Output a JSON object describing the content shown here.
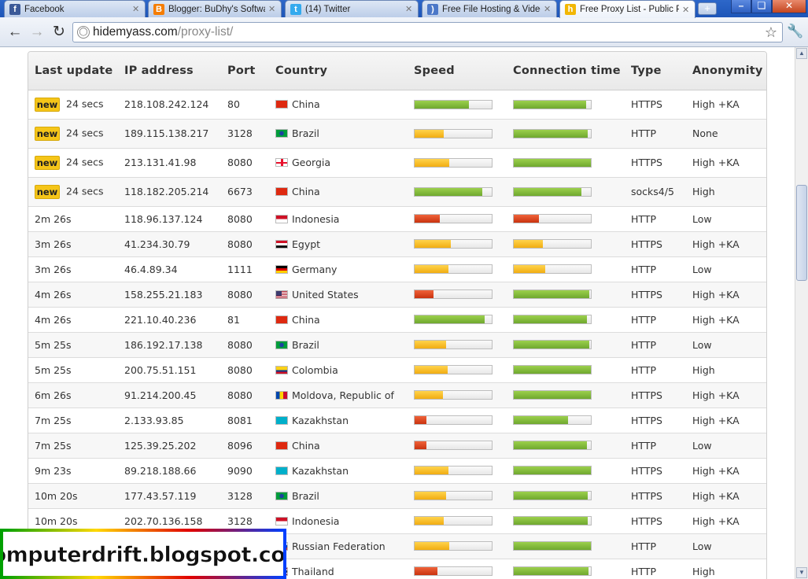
{
  "tabs": [
    {
      "label": "Facebook",
      "icon": "facebook-icon",
      "color": "#3b5998",
      "glyph": "f"
    },
    {
      "label": "Blogger: BuDhy's Software",
      "icon": "blogger-icon",
      "color": "#f57d00",
      "glyph": "B"
    },
    {
      "label": "(14) Twitter",
      "icon": "twitter-icon",
      "color": "#33aaee",
      "glyph": "t"
    },
    {
      "label": "Free File Hosting & Video D",
      "icon": "loading-icon",
      "color": "#4c78c8",
      "glyph": ")"
    },
    {
      "label": "Free Proxy List - Public Pro",
      "icon": "hidemyass-icon",
      "color": "#f2b705",
      "glyph": "h",
      "active": true
    }
  ],
  "address_bar": {
    "host": "hidemyass.com",
    "path": "/proxy-list/"
  },
  "table": {
    "headers": [
      "Last update",
      "IP address",
      "Port",
      "Country",
      "Speed",
      "Connection time",
      "Type",
      "Anonymity"
    ],
    "new_label": "new",
    "rows": [
      {
        "new": true,
        "update": "24 secs",
        "ip": "218.108.242.124",
        "port": "80",
        "country": "China",
        "flag": "cn",
        "speed": 0.7,
        "speed_level": "fast",
        "conn": 0.94,
        "conn_level": "fast",
        "type": "HTTPS",
        "anon": "High +KA"
      },
      {
        "new": true,
        "update": "24 secs",
        "ip": "189.115.138.217",
        "port": "3128",
        "country": "Brazil",
        "flag": "br",
        "speed": 0.38,
        "speed_level": "medium",
        "conn": 0.96,
        "conn_level": "fast",
        "type": "HTTP",
        "anon": "None"
      },
      {
        "new": true,
        "update": "24 secs",
        "ip": "213.131.41.98",
        "port": "8080",
        "country": "Georgia",
        "flag": "ge",
        "speed": 0.45,
        "speed_level": "medium",
        "conn": 1.0,
        "conn_level": "fast",
        "type": "HTTPS",
        "anon": "High +KA"
      },
      {
        "new": true,
        "update": "24 secs",
        "ip": "118.182.205.214",
        "port": "6673",
        "country": "China",
        "flag": "cn",
        "speed": 0.88,
        "speed_level": "fast",
        "conn": 0.88,
        "conn_level": "fast",
        "type": "socks4/5",
        "anon": "High"
      },
      {
        "new": false,
        "update": "2m 26s",
        "ip": "118.96.137.124",
        "port": "8080",
        "country": "Indonesia",
        "flag": "id",
        "speed": 0.33,
        "speed_level": "slow",
        "conn": 0.33,
        "conn_level": "slow",
        "type": "HTTP",
        "anon": "Low"
      },
      {
        "new": false,
        "update": "3m 26s",
        "ip": "41.234.30.79",
        "port": "8080",
        "country": "Egypt",
        "flag": "eg",
        "speed": 0.47,
        "speed_level": "medium",
        "conn": 0.38,
        "conn_level": "medium",
        "type": "HTTPS",
        "anon": "High +KA"
      },
      {
        "new": false,
        "update": "3m 26s",
        "ip": "46.4.89.34",
        "port": "1111",
        "country": "Germany",
        "flag": "de",
        "speed": 0.44,
        "speed_level": "medium",
        "conn": 0.41,
        "conn_level": "medium",
        "type": "HTTP",
        "anon": "Low"
      },
      {
        "new": false,
        "update": "4m 26s",
        "ip": "158.255.21.183",
        "port": "8080",
        "country": "United States",
        "flag": "us",
        "speed": 0.24,
        "speed_level": "slow",
        "conn": 0.98,
        "conn_level": "fast",
        "type": "HTTPS",
        "anon": "High +KA"
      },
      {
        "new": false,
        "update": "4m 26s",
        "ip": "221.10.40.236",
        "port": "81",
        "country": "China",
        "flag": "cn",
        "speed": 0.91,
        "speed_level": "fast",
        "conn": 0.95,
        "conn_level": "fast",
        "type": "HTTP",
        "anon": "High +KA"
      },
      {
        "new": false,
        "update": "5m 25s",
        "ip": "186.192.17.138",
        "port": "8080",
        "country": "Brazil",
        "flag": "br",
        "speed": 0.41,
        "speed_level": "medium",
        "conn": 0.98,
        "conn_level": "fast",
        "type": "HTTP",
        "anon": "Low"
      },
      {
        "new": false,
        "update": "5m 25s",
        "ip": "200.75.51.151",
        "port": "8080",
        "country": "Colombia",
        "flag": "co",
        "speed": 0.43,
        "speed_level": "medium",
        "conn": 1.0,
        "conn_level": "fast",
        "type": "HTTP",
        "anon": "High"
      },
      {
        "new": false,
        "update": "6m 26s",
        "ip": "91.214.200.45",
        "port": "8080",
        "country": "Moldova, Republic of",
        "flag": "md",
        "speed": 0.37,
        "speed_level": "medium",
        "conn": 1.0,
        "conn_level": "fast",
        "type": "HTTPS",
        "anon": "High +KA"
      },
      {
        "new": false,
        "update": "7m 25s",
        "ip": "2.133.93.85",
        "port": "8081",
        "country": "Kazakhstan",
        "flag": "kz",
        "speed": 0.15,
        "speed_level": "slow",
        "conn": 0.7,
        "conn_level": "fast",
        "type": "HTTPS",
        "anon": "High +KA"
      },
      {
        "new": false,
        "update": "7m 25s",
        "ip": "125.39.25.202",
        "port": "8096",
        "country": "China",
        "flag": "cn",
        "speed": 0.15,
        "speed_level": "slow",
        "conn": 0.95,
        "conn_level": "fast",
        "type": "HTTP",
        "anon": "Low"
      },
      {
        "new": false,
        "update": "9m 23s",
        "ip": "89.218.188.66",
        "port": "9090",
        "country": "Kazakhstan",
        "flag": "kz",
        "speed": 0.44,
        "speed_level": "medium",
        "conn": 1.0,
        "conn_level": "fast",
        "type": "HTTPS",
        "anon": "High +KA"
      },
      {
        "new": false,
        "update": "10m 20s",
        "ip": "177.43.57.119",
        "port": "3128",
        "country": "Brazil",
        "flag": "br",
        "speed": 0.41,
        "speed_level": "medium",
        "conn": 0.96,
        "conn_level": "fast",
        "type": "HTTPS",
        "anon": "High +KA"
      },
      {
        "new": false,
        "update": "10m 20s",
        "ip": "202.70.136.158",
        "port": "3128",
        "country": "Indonesia",
        "flag": "id",
        "speed": 0.38,
        "speed_level": "medium",
        "conn": 0.96,
        "conn_level": "fast",
        "type": "HTTPS",
        "anon": "High +KA"
      },
      {
        "new": false,
        "update": "",
        "ip": "",
        "port": "",
        "country": "Russian Federation",
        "flag": "ru",
        "speed": 0.45,
        "speed_level": "medium",
        "conn": 1.0,
        "conn_level": "fast",
        "type": "HTTP",
        "anon": "Low"
      },
      {
        "new": false,
        "update": "",
        "ip": "",
        "port": "",
        "country": "Thailand",
        "flag": "th",
        "speed": 0.3,
        "speed_level": "slow",
        "conn": 0.97,
        "conn_level": "fast",
        "type": "HTTP",
        "anon": "High"
      }
    ]
  },
  "watermark": {
    "text": "computerdrift.blogspot.com"
  },
  "colors": {
    "fast": "#7fbf3a",
    "medium": "#f6be2a",
    "slow": "#dc4a22",
    "new_badge": "#f5c518"
  }
}
